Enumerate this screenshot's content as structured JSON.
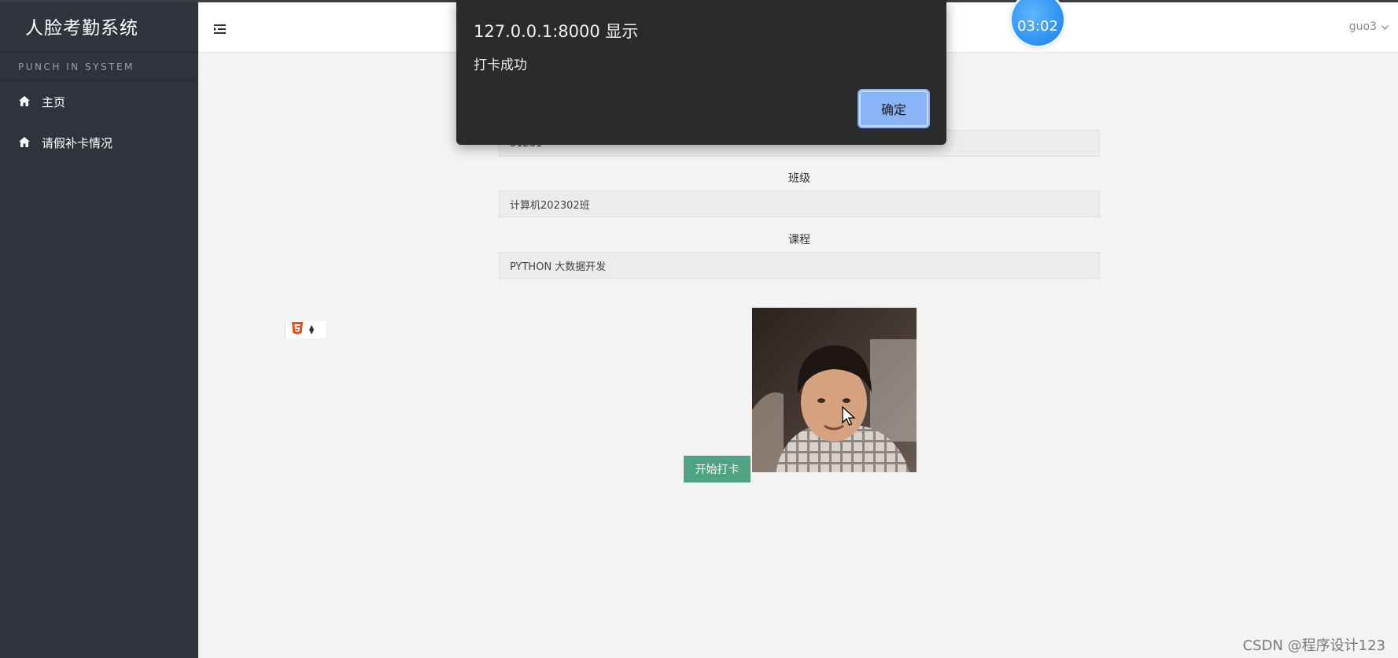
{
  "sidebar": {
    "brand": "人脸考勤系统",
    "subtitle": "PUNCH IN SYSTEM",
    "items": [
      {
        "label": "主页",
        "icon": "home-icon"
      },
      {
        "label": "请假补卡情况",
        "icon": "home-icon"
      }
    ]
  },
  "topbar": {
    "menu_icon": "menu-toggle-icon",
    "user": "guo3",
    "user_icon": "chevron-down-icon"
  },
  "timer": {
    "text": "03:02"
  },
  "form": {
    "id_value": "31231",
    "class_label": "班级",
    "class_value": "计算机202302班",
    "course_label": "课程",
    "course_value": "PYTHON 大数据开发"
  },
  "punch_button": "开始打卡",
  "dialog": {
    "title": "127.0.0.1:8000 显示",
    "message": "打卡成功",
    "ok": "确定"
  },
  "watermark": "CSDN @程序设计123",
  "colors": {
    "sidebar_bg": "#2f333b",
    "content_bg": "#f3f3f3",
    "punch_button": "#4fa383",
    "dialog_bg": "#2a2b2d",
    "dialog_ok": "#8ab4f8",
    "timer": "#2a8ff0"
  }
}
